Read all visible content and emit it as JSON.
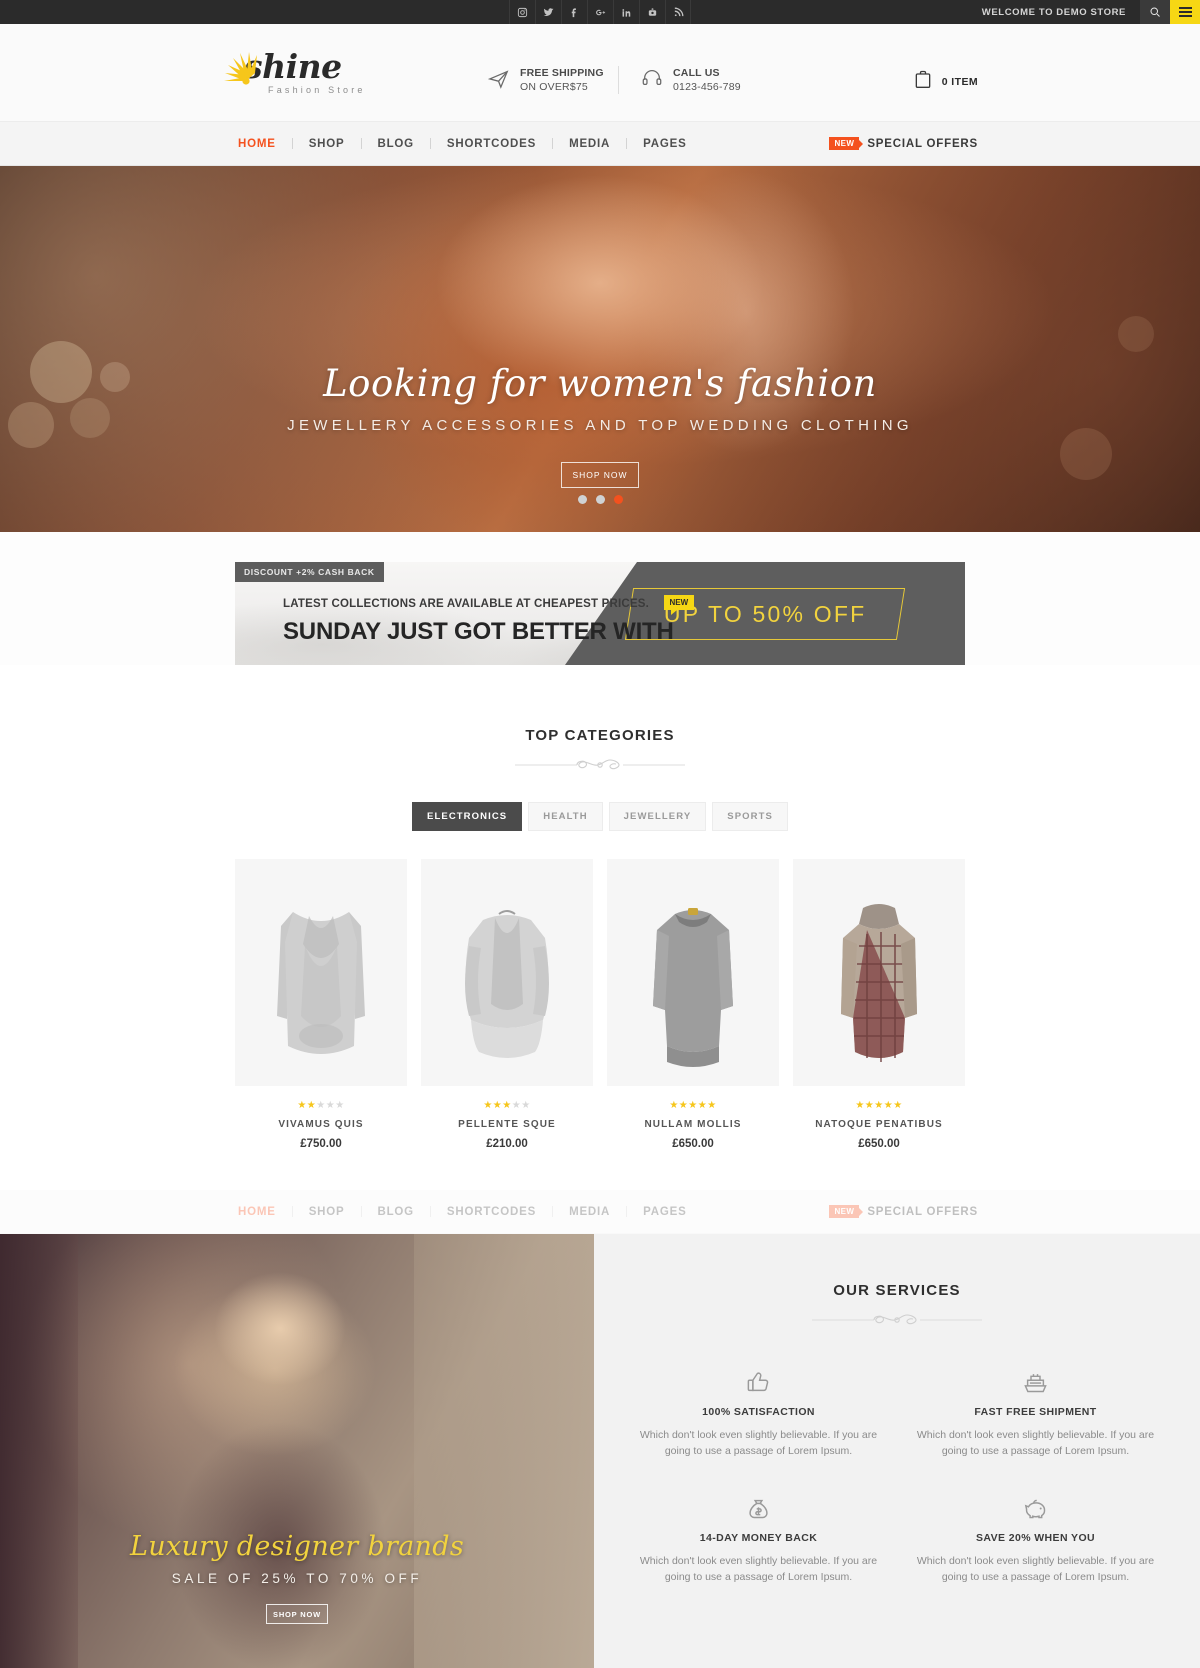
{
  "topbar": {
    "social": [
      {
        "name": "instagram-icon",
        "label": "Instagram"
      },
      {
        "name": "twitter-icon",
        "label": "Twitter"
      },
      {
        "name": "facebook-icon",
        "label": "Facebook"
      },
      {
        "name": "google-plus-icon",
        "label": "Google Plus"
      },
      {
        "name": "linkedin-icon",
        "label": "LinkedIn"
      },
      {
        "name": "youtube-icon",
        "label": "YouTube"
      },
      {
        "name": "rss-icon",
        "label": "RSS"
      }
    ],
    "welcome": "WELCOME TO DEMO STORE"
  },
  "header": {
    "logo_name": "shine",
    "logo_sub": "Fashion Store",
    "free_shipping_line1": "FREE SHIPPING",
    "free_shipping_line2": "ON OVER$75",
    "call_line1": "CALL US",
    "call_line2": "0123-456-789",
    "cart_label": "0 ITEM"
  },
  "nav": {
    "items": [
      {
        "label": "HOME",
        "active": true
      },
      {
        "label": "SHOP",
        "active": false
      },
      {
        "label": "BLOG",
        "active": false
      },
      {
        "label": "SHORTCODES",
        "active": false
      },
      {
        "label": "MEDIA",
        "active": false
      },
      {
        "label": "PAGES",
        "active": false
      }
    ],
    "badge": "NEW",
    "special_offers": "SPECIAL OFFERS"
  },
  "hero": {
    "title": "Looking for women's fashion",
    "subtitle": "JEWELLERY ACCESSORIES AND TOP WEDDING CLOTHING",
    "button": "SHOP NOW",
    "dots": [
      false,
      false,
      true
    ],
    "accent_color": "#f4511e"
  },
  "promo": {
    "tag": "DISCOUNT +2% CASH BACK",
    "line1": "LATEST COLLECTIONS ARE AVAILABLE AT CHEAPEST PRICES.",
    "new_badge": "NEW",
    "line2": "SUNDAY JUST GOT BETTER WITH",
    "offer": "UP TO 50% OFF",
    "offer_color": "#f2d33e",
    "panel_color": "#5e5e5e"
  },
  "categories": {
    "title": "TOP CATEGORIES",
    "tabs": [
      {
        "label": "ELECTRONICS",
        "active": true
      },
      {
        "label": "HEALTH",
        "active": false
      },
      {
        "label": "JEWELLERY",
        "active": false
      },
      {
        "label": "SPORTS",
        "active": false
      }
    ],
    "products": [
      {
        "name": "VIVAMUS QUIS",
        "price": "£750.00",
        "rating": 2
      },
      {
        "name": "PELLENTE SQUE",
        "price": "£210.00",
        "rating": 3
      },
      {
        "name": "NULLAM MOLLIS",
        "price": "£650.00",
        "rating": 5
      },
      {
        "name": "NATOQUE PENATIBUS",
        "price": "£650.00",
        "rating": 5
      }
    ]
  },
  "promo_left": {
    "title": "Luxury designer brands",
    "subtitle": "SALE OF 25% TO 70% OFF",
    "button": "SHOP NOW",
    "title_color": "#f2d33e"
  },
  "services": {
    "title": "OUR SERVICES",
    "items": [
      {
        "icon": "thumbs-up-icon",
        "title": "100% SATISFACTION",
        "desc": "Which don't look even slightly believable. If you are going to use a passage of Lorem Ipsum."
      },
      {
        "icon": "ship-icon",
        "title": "FAST FREE SHIPMENT",
        "desc": "Which don't look even slightly believable. If you are going to use a passage of Lorem Ipsum."
      },
      {
        "icon": "money-bag-icon",
        "title": "14-DAY MONEY BACK",
        "desc": "Which don't look even slightly believable. If you are going to use a passage of Lorem Ipsum."
      },
      {
        "icon": "piggy-bank-icon",
        "title": "SAVE 20% WHEN YOU",
        "desc": "Which don't look even slightly believable. If you are going to use a passage of Lorem Ipsum."
      }
    ]
  }
}
